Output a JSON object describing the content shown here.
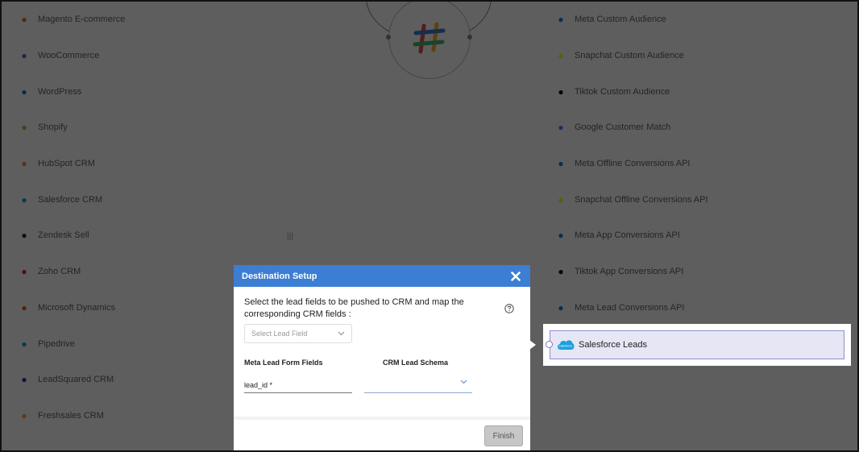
{
  "background": {
    "left_items": [
      {
        "label": "Magento E-commerce",
        "icon": "magento-icon",
        "color": "#e86b2e"
      },
      {
        "label": "WooCommerce",
        "icon": "woocommerce-icon",
        "color": "#7f54b3"
      },
      {
        "label": "WordPress",
        "icon": "wordpress-icon",
        "color": "#21759b"
      },
      {
        "label": "Shopify",
        "icon": "shopify-icon",
        "color": "#95bf47"
      },
      {
        "label": "HubSpot CRM",
        "icon": "hubspot-icon",
        "color": "#ff7a59"
      },
      {
        "label": "Salesforce CRM",
        "icon": "salesforce-icon",
        "color": "#00a1e0"
      },
      {
        "label": "Zendesk Sell",
        "icon": "zendesk-icon",
        "color": "#03363d"
      },
      {
        "label": "Zoho CRM",
        "icon": "zoho-icon",
        "color": "#e42527"
      },
      {
        "label": "Microsoft Dynamics",
        "icon": "microsoft-icon",
        "color": "#f25022"
      },
      {
        "label": "Pipedrive",
        "icon": "pipedrive-icon",
        "color": "#1a9bd7"
      },
      {
        "label": "LeadSquared CRM",
        "icon": "leadsquared-icon",
        "color": "#1e3a8a"
      },
      {
        "label": "Freshsales CRM",
        "icon": "freshsales-icon",
        "color": "#f5a623"
      }
    ],
    "right_items": [
      {
        "label": "Meta Custom Audience",
        "icon": "meta-icon",
        "color": "#1877f2"
      },
      {
        "label": "Snapchat Custom Audience",
        "icon": "snapchat-icon",
        "color": "#fffc00"
      },
      {
        "label": "Tiktok Custom Audience",
        "icon": "tiktok-icon",
        "color": "#111111"
      },
      {
        "label": "Google Customer Match",
        "icon": "google-ads-icon",
        "color": "#4285f4"
      },
      {
        "label": "Meta Offline Conversions API",
        "icon": "meta-icon",
        "color": "#1877f2"
      },
      {
        "label": "Snapchat Offline Conversions API",
        "icon": "snapchat-icon",
        "color": "#fffc00"
      },
      {
        "label": "Meta App Conversions API",
        "icon": "meta-icon",
        "color": "#1877f2"
      },
      {
        "label": "Tiktok App Conversions API",
        "icon": "tiktok-icon",
        "color": "#111111"
      },
      {
        "label": "Meta Lead Conversions API",
        "icon": "meta-icon",
        "color": "#1877f2"
      }
    ]
  },
  "modal": {
    "title": "Destination Setup",
    "instruction": "Select the lead fields to be pushed to CRM and map the corresponding CRM fields :",
    "select_placeholder": "Select Lead Field",
    "col_meta": "Meta Lead Form Fields",
    "col_crm": "CRM Lead Schema",
    "mapping": [
      {
        "field": "lead_id *",
        "crm_value": ""
      }
    ],
    "finish_label": "Finish",
    "header_color": "#3b7ed3"
  },
  "destination": {
    "label": "Salesforce Leads",
    "logo_text": "salesforce",
    "icon": "salesforce-icon"
  }
}
